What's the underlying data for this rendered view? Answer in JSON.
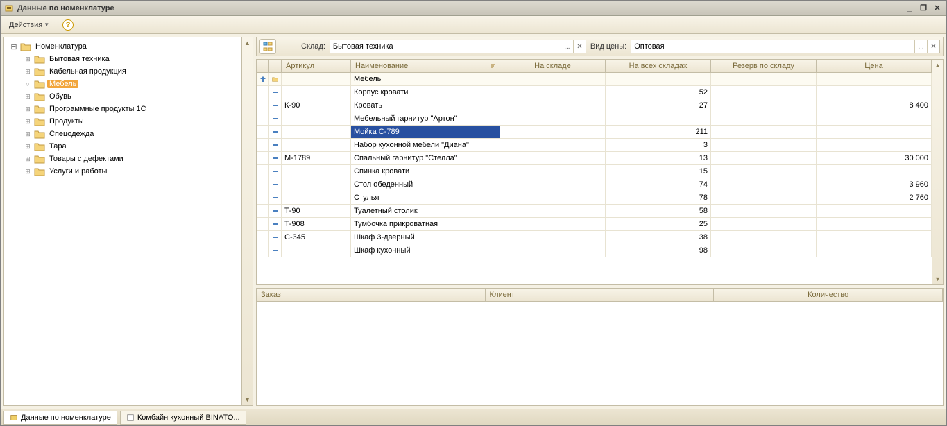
{
  "window": {
    "title": "Данные по номенклатуре"
  },
  "toolbar": {
    "actions": "Действия"
  },
  "tree": {
    "root": "Номенклатура",
    "items": [
      {
        "label": "Бытовая техника",
        "marker": "plus"
      },
      {
        "label": "Кабельная продукция",
        "marker": "plus"
      },
      {
        "label": "Мебель",
        "marker": "dot",
        "selected": true
      },
      {
        "label": "Обувь",
        "marker": "plus"
      },
      {
        "label": "Программные продукты 1С",
        "marker": "plus"
      },
      {
        "label": "Продукты",
        "marker": "plus"
      },
      {
        "label": "Спецодежда",
        "marker": "plus"
      },
      {
        "label": "Тара",
        "marker": "plus"
      },
      {
        "label": "Товары с дефектами",
        "marker": "plus"
      },
      {
        "label": "Услуги и работы",
        "marker": "plus"
      }
    ]
  },
  "filter": {
    "sklad_label": "Склад:",
    "sklad_value": "Бытовая техника",
    "price_label": "Вид цены:",
    "price_value": "Оптовая"
  },
  "grid": {
    "columns": {
      "c0": "",
      "c1": "",
      "c2": "Артикул",
      "c3": "Наименование",
      "c4": "На складе",
      "c5": "На всех складах",
      "c6": "Резерв по складу",
      "c7": "Цена"
    },
    "group_name": "Мебель",
    "rows": [
      {
        "art": "",
        "name": "Корпус кровати",
        "all": "52",
        "price": ""
      },
      {
        "art": "К-90",
        "name": "Кровать",
        "all": "27",
        "price": "8 400"
      },
      {
        "art": "",
        "name": "Мебельный гарнитур \"Артон\"",
        "all": "",
        "price": ""
      },
      {
        "art": "",
        "name": "Мойка С-789",
        "all": "211",
        "price": "",
        "selected": true
      },
      {
        "art": "",
        "name": "Набор кухонной мебели \"Диана\"",
        "all": "3",
        "price": ""
      },
      {
        "art": "М-1789",
        "name": "Спальный гарнитур \"Стелла\"",
        "all": "13",
        "price": "30 000"
      },
      {
        "art": "",
        "name": "Спинка кровати",
        "all": "15",
        "price": ""
      },
      {
        "art": "",
        "name": "Стол обеденный",
        "all": "74",
        "price": "3 960"
      },
      {
        "art": "",
        "name": "Стулья",
        "all": "78",
        "price": "2 760"
      },
      {
        "art": "Т-90",
        "name": "Туалетный столик",
        "all": "58",
        "price": ""
      },
      {
        "art": "Т-908",
        "name": "Тумбочка прикроватная",
        "all": "25",
        "price": ""
      },
      {
        "art": "С-345",
        "name": "Шкаф 3-дверный",
        "all": "38",
        "price": ""
      },
      {
        "art": "",
        "name": "Шкаф кухонный",
        "all": "98",
        "price": ""
      }
    ]
  },
  "bottom": {
    "c1": "Заказ",
    "c2": "Клиент",
    "c3": "Количество"
  },
  "status": {
    "tab1": "Данные по номенклатуре",
    "tab2": "Комбайн кухонный BINATO..."
  }
}
